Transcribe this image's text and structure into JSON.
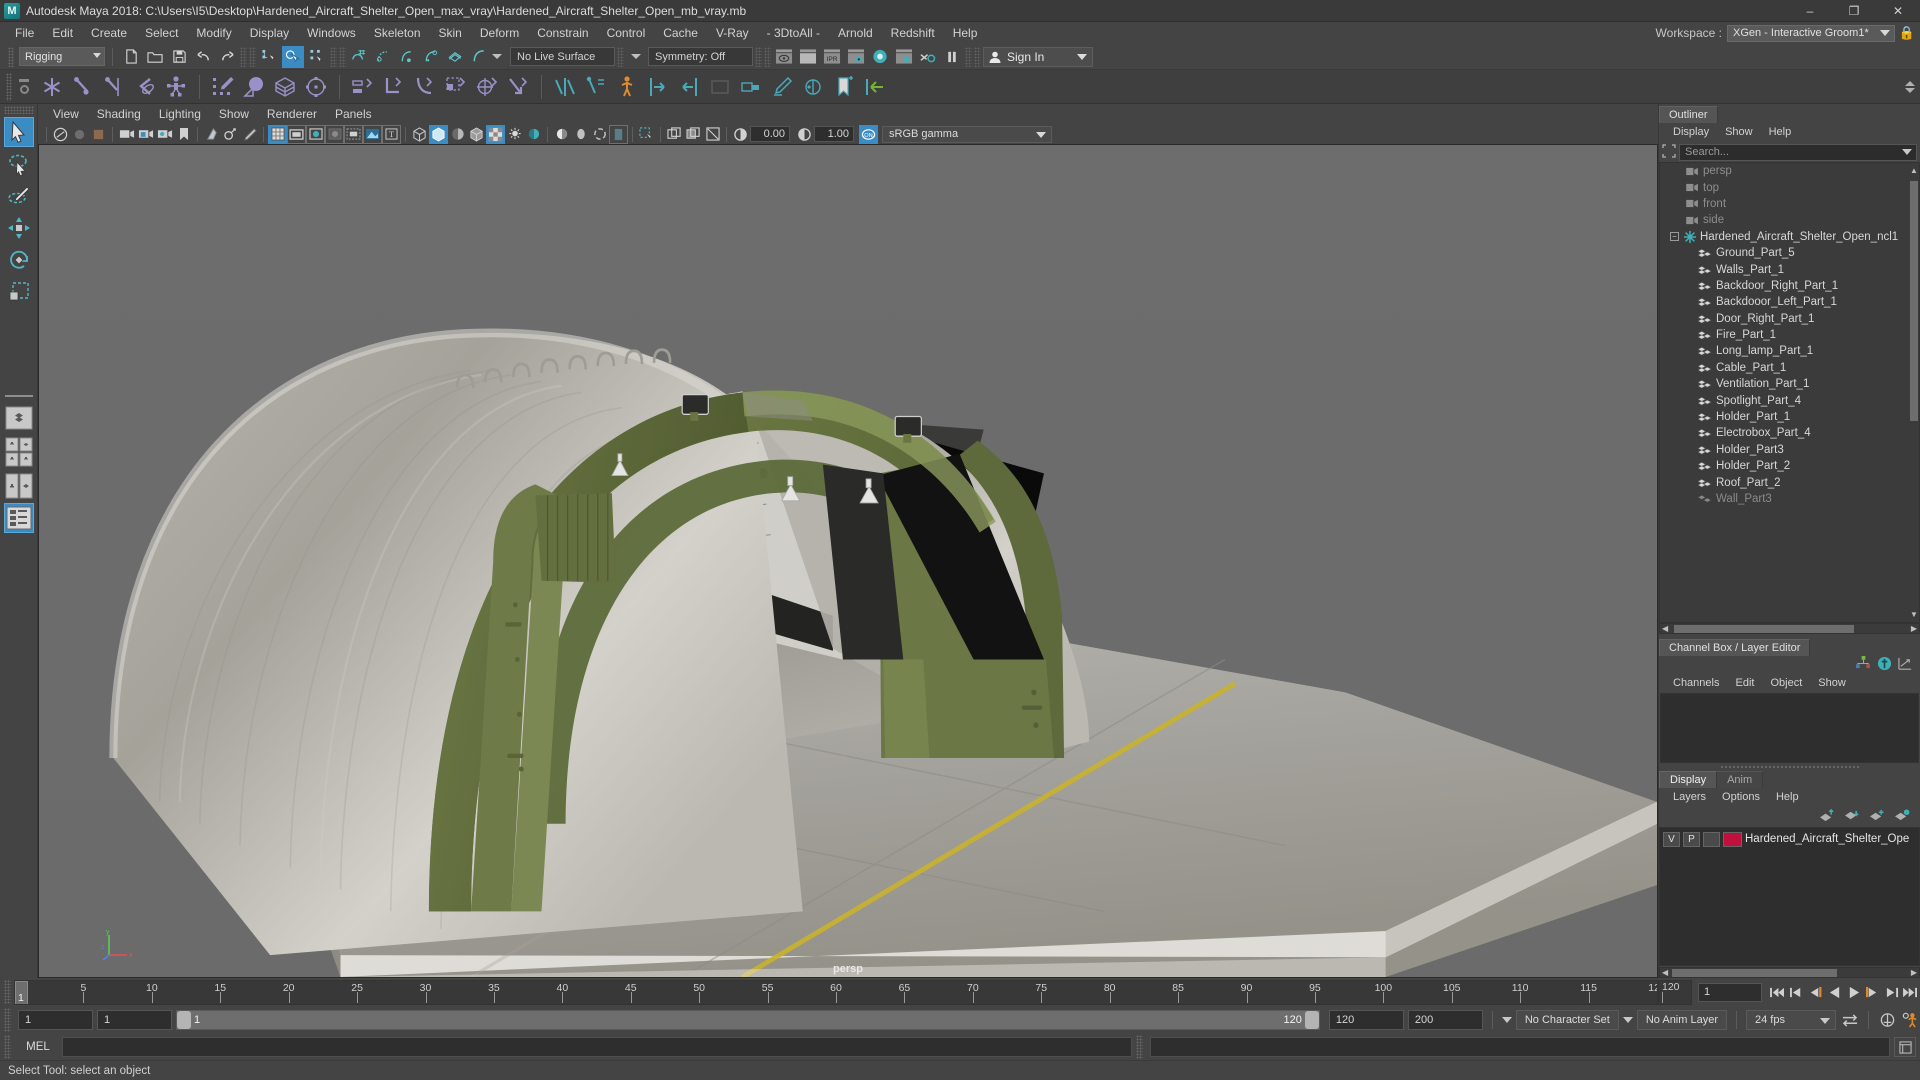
{
  "titlebar": {
    "app_title": "Autodesk Maya 2018: C:\\Users\\I5\\Desktop\\Hardened_Aircraft_Shelter_Open_max_vray\\Hardened_Aircraft_Shelter_Open_mb_vray.mb",
    "logo_text": "M",
    "minimize": "–",
    "maximize": "❐",
    "close": "✕"
  },
  "menubar": {
    "items": [
      "File",
      "Edit",
      "Create",
      "Select",
      "Modify",
      "Display",
      "Windows",
      "Skeleton",
      "Skin",
      "Deform",
      "Constrain",
      "Control",
      "Cache",
      "V-Ray",
      "- 3DtoAll -",
      "Arnold",
      "Redshift",
      "Help"
    ],
    "workspace_label": "Workspace :",
    "workspace_value": "XGen - Interactive Groom1*"
  },
  "statusline": {
    "menuset": "Rigging",
    "live_surface": "No Live Surface",
    "symmetry": "Symmetry: Off",
    "signin": "Sign In"
  },
  "viewport_menus": [
    "View",
    "Shading",
    "Lighting",
    "Show",
    "Renderer",
    "Panels"
  ],
  "viewport_toolbar": {
    "exposure_value": "0.00",
    "gamma_value": "1.00",
    "color_space": "sRGB gamma"
  },
  "viewport": {
    "camera_label": "persp",
    "axis_x": "x",
    "axis_y": "y",
    "axis_z": "z"
  },
  "outliner": {
    "tab_label": "Outliner",
    "menus": [
      "Display",
      "Show",
      "Help"
    ],
    "search_placeholder": "Search...",
    "items": [
      {
        "label": "persp",
        "type": "camera",
        "dim": true
      },
      {
        "label": "top",
        "type": "camera",
        "dim": true
      },
      {
        "label": "front",
        "type": "camera",
        "dim": true
      },
      {
        "label": "side",
        "type": "camera",
        "dim": true
      },
      {
        "label": "Hardened_Aircraft_Shelter_Open_ncl1",
        "type": "group",
        "dim": false
      },
      {
        "label": "Ground_Part_5",
        "type": "mesh",
        "dim": false
      },
      {
        "label": "Walls_Part_1",
        "type": "mesh",
        "dim": false
      },
      {
        "label": "Backdoor_Right_Part_1",
        "type": "mesh",
        "dim": false
      },
      {
        "label": "Backdooor_Left_Part_1",
        "type": "mesh",
        "dim": false
      },
      {
        "label": "Door_Right_Part_1",
        "type": "mesh",
        "dim": false
      },
      {
        "label": "Fire_Part_1",
        "type": "mesh",
        "dim": false
      },
      {
        "label": "Long_lamp_Part_1",
        "type": "mesh",
        "dim": false
      },
      {
        "label": "Cable_Part_1",
        "type": "mesh",
        "dim": false
      },
      {
        "label": "Ventilation_Part_1",
        "type": "mesh",
        "dim": false
      },
      {
        "label": "Spotlight_Part_4",
        "type": "mesh",
        "dim": false
      },
      {
        "label": "Holder_Part_1",
        "type": "mesh",
        "dim": false
      },
      {
        "label": "Electrobox_Part_4",
        "type": "mesh",
        "dim": false
      },
      {
        "label": "Holder_Part3",
        "type": "mesh",
        "dim": false
      },
      {
        "label": "Holder_Part_2",
        "type": "mesh",
        "dim": false
      },
      {
        "label": "Roof_Part_2",
        "type": "mesh",
        "dim": false
      },
      {
        "label": "Wall_Part3",
        "type": "mesh",
        "dim": false
      }
    ]
  },
  "channelbox": {
    "tab_label": "Channel Box / Layer Editor",
    "menus": [
      "Channels",
      "Edit",
      "Object",
      "Show"
    ]
  },
  "layereditor": {
    "tabs": [
      "Display",
      "Anim"
    ],
    "active_tab": "Display",
    "menus": [
      "Layers",
      "Options",
      "Help"
    ],
    "layers": [
      {
        "visible": "V",
        "playback": "P",
        "type": "",
        "color": "#c0103c",
        "name": "Hardened_Aircraft_Shelter_Ope"
      }
    ]
  },
  "timeline": {
    "ticks": [
      5,
      10,
      15,
      20,
      25,
      30,
      35,
      40,
      45,
      50,
      55,
      60,
      65,
      70,
      75,
      80,
      85,
      90,
      95,
      100,
      105,
      110,
      115,
      120
    ],
    "current_frame": "1",
    "start_frame": "1",
    "end_frame": "120",
    "current_field": "1"
  },
  "rangeslider": {
    "anim_start": "1",
    "anim_current_start": "1",
    "range_start": "1",
    "range_end": "120",
    "playback_end": "120",
    "anim_end": "200",
    "character_set": "No Character Set",
    "anim_layer": "No Anim Layer",
    "fps": "24 fps"
  },
  "commandline": {
    "language": "MEL",
    "input_value": "",
    "output_value": ""
  },
  "helpline": {
    "message": "Select Tool: select an object"
  }
}
